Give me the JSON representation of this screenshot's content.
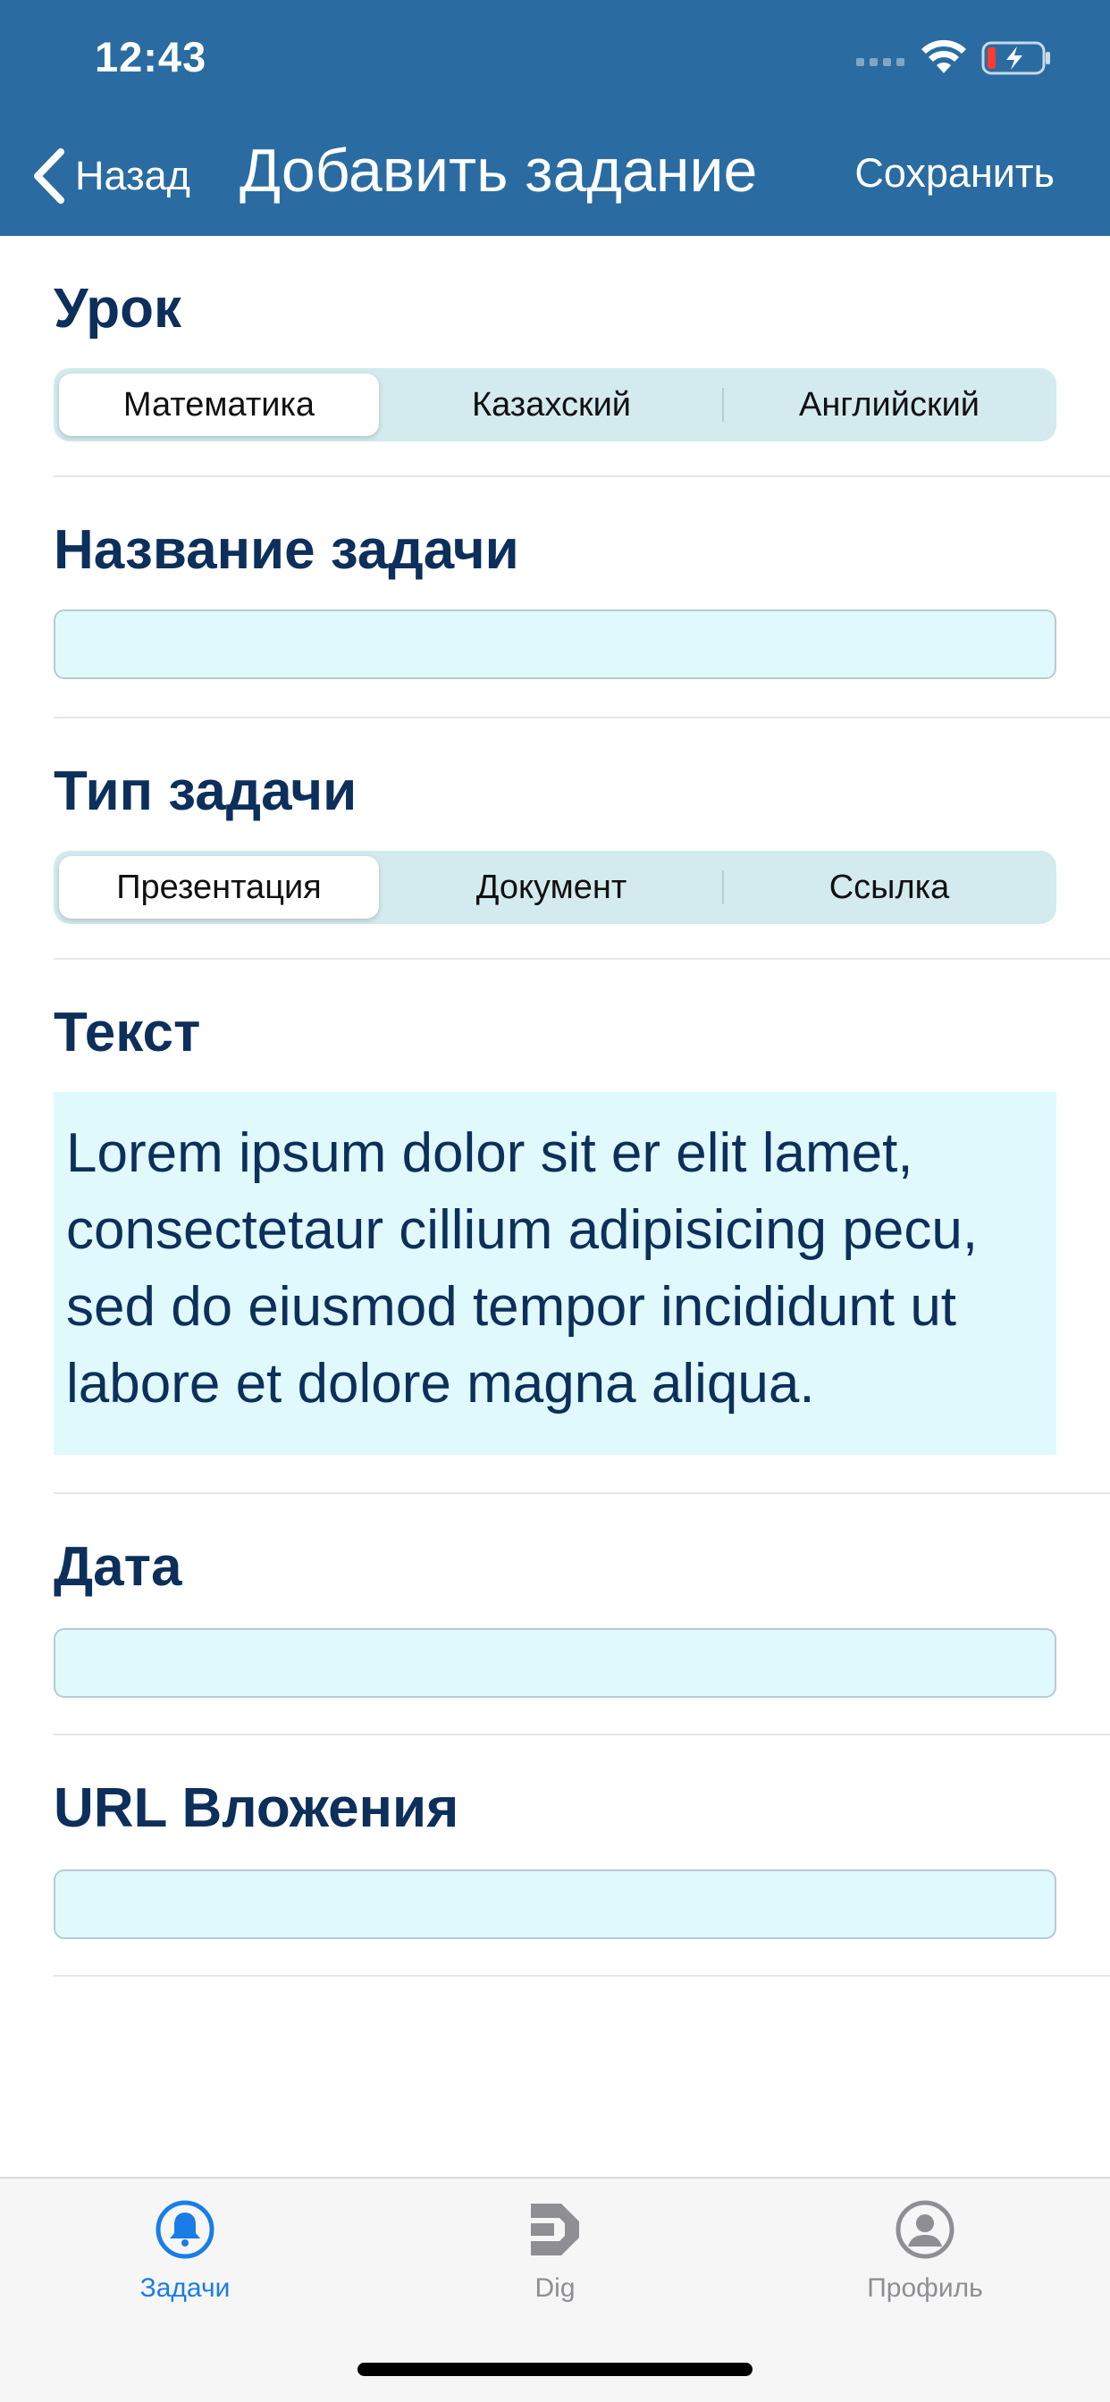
{
  "status_bar": {
    "time": "12:43"
  },
  "nav": {
    "back_label": "Назад",
    "title": "Добавить задание",
    "save_label": "Сохранить"
  },
  "form": {
    "lesson": {
      "title": "Урок",
      "options": [
        "Математика",
        "Казахский",
        "Английский"
      ],
      "selected": "Математика"
    },
    "task_name": {
      "title": "Название задачи",
      "value": ""
    },
    "task_type": {
      "title": "Тип задачи",
      "options": [
        "Презентация",
        "Документ",
        "Ссылка"
      ],
      "selected": "Презентация"
    },
    "text": {
      "title": "Текст",
      "value": "Lorem ipsum dolor sit er elit lamet, consectetaur cillium adipisicing pecu, sed do eiusmod tempor incididunt ut labore et dolore magna aliqua."
    },
    "date": {
      "title": "Дата",
      "value": ""
    },
    "attachment_url": {
      "title": "URL Вложения",
      "value": ""
    }
  },
  "tab_bar": {
    "items": [
      {
        "label": "Задачи",
        "icon": "bell-icon",
        "active": true
      },
      {
        "label": "Dig",
        "icon": "dig-logo-icon",
        "active": false
      },
      {
        "label": "Профиль",
        "icon": "person-circle-icon",
        "active": false
      }
    ]
  },
  "colors": {
    "header_bg": "#2a6ca2",
    "title_text": "#0d2f5b",
    "input_bg": "#e0f9fd",
    "segment_bg": "#d3eaee",
    "tab_active": "#1a7de6",
    "tab_inactive": "#8e8e93"
  }
}
